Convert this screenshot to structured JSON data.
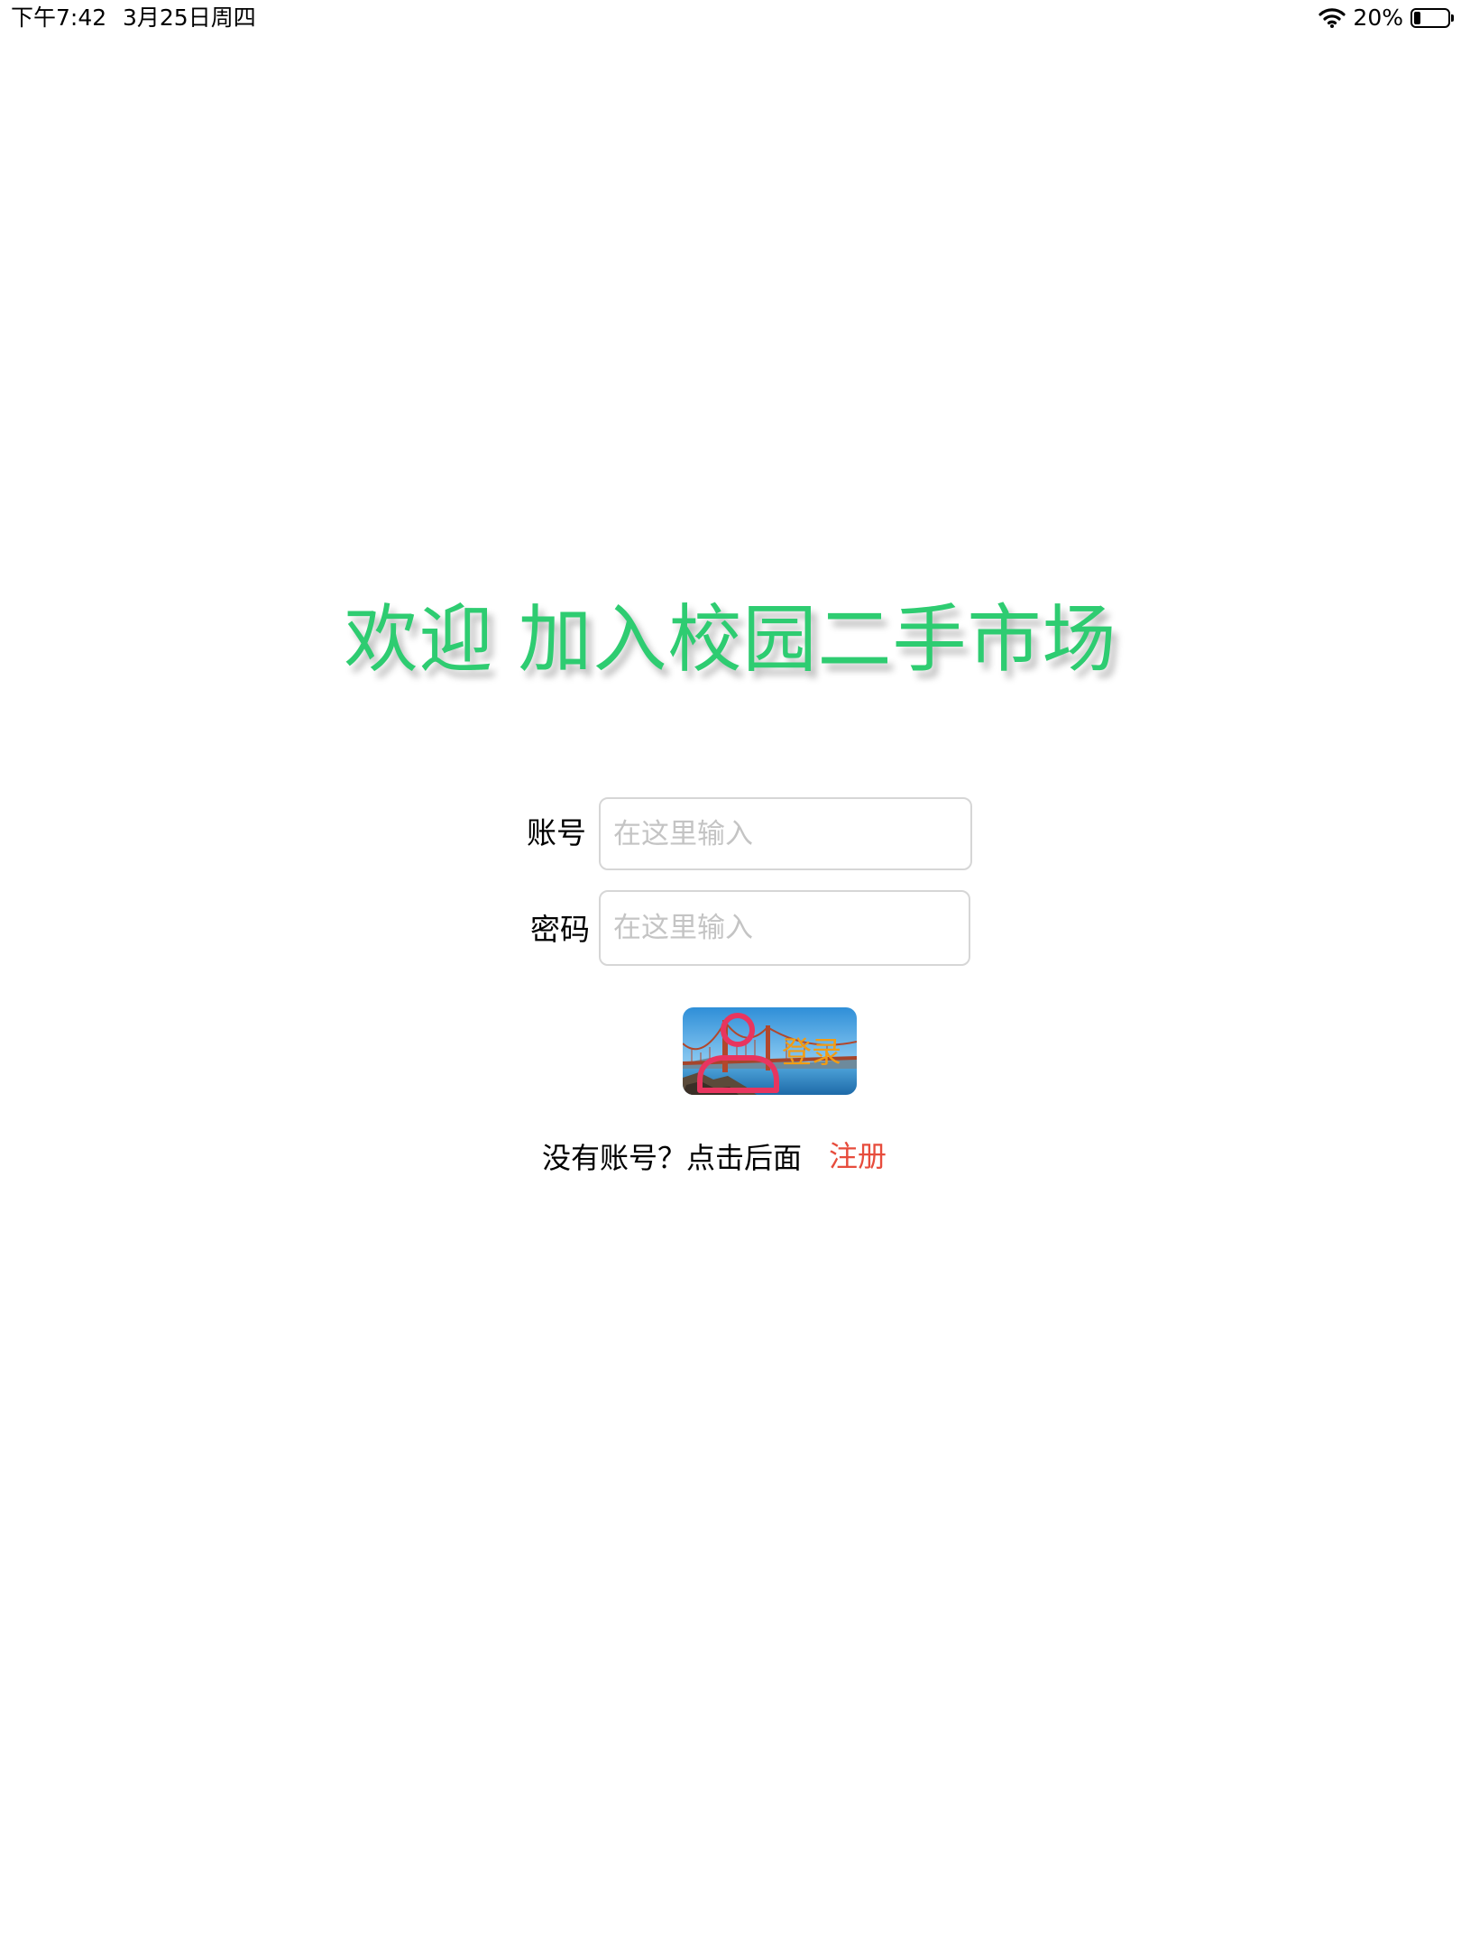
{
  "status_bar": {
    "time": "下午7:42",
    "date": "3月25日周四",
    "battery_text": "20%",
    "battery_level": 0.2,
    "icons": [
      "wifi-icon",
      "battery-icon"
    ]
  },
  "main": {
    "title": "欢迎 加入校园二手市场",
    "account_label": "账号",
    "account_placeholder": "在这里输入",
    "account_value": "",
    "password_label": "密码",
    "password_placeholder": "在这里输入",
    "password_value": "",
    "login_label": "登录",
    "login_icon": "person-icon",
    "register_prompt": "没有账号？点击后面",
    "register_link": "注册"
  },
  "colors": {
    "title": "#2ecc71",
    "login_label": "#f39c12",
    "register_link": "#e74c3c",
    "person_icon": "#e8355f"
  }
}
